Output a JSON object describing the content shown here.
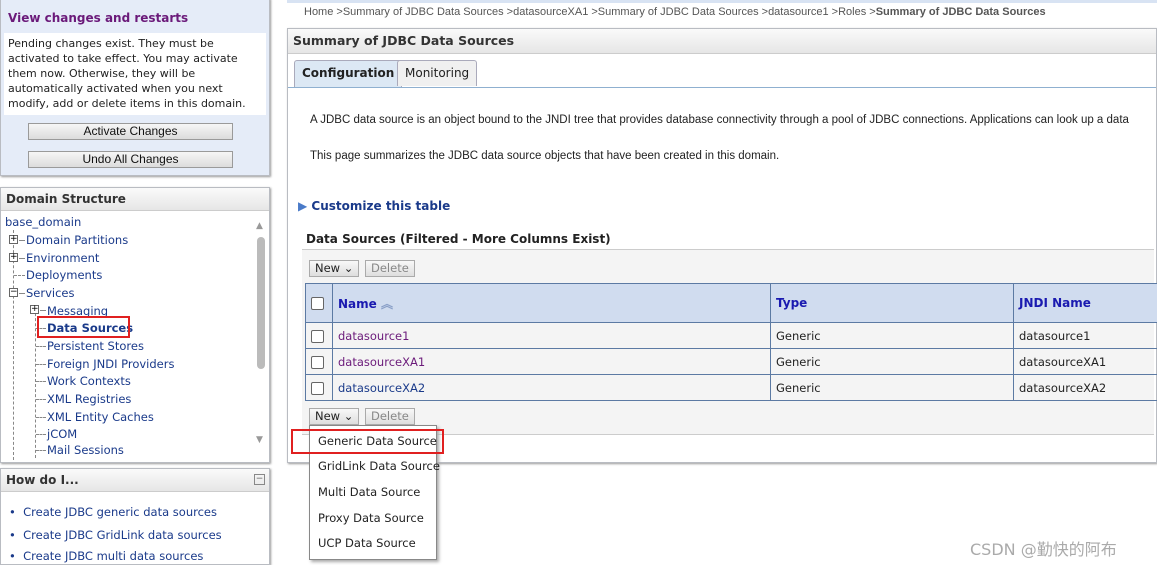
{
  "change_center": {
    "title": "View changes and restarts",
    "message": "Pending changes exist. They must be activated to take effect. You may activate them now. Otherwise, they will be automatically activated when you next modify, add or delete items in this domain.",
    "activate_label": "Activate Changes",
    "undo_label": "Undo All Changes"
  },
  "domain_structure": {
    "title": "Domain Structure",
    "root": "base_domain",
    "items": [
      "Domain Partitions",
      "Environment",
      "Deployments",
      "Services",
      "Messaging",
      "Data Sources",
      "Persistent Stores",
      "Foreign JNDI Providers",
      "Work Contexts",
      "XML Registries",
      "XML Entity Caches",
      "jCOM",
      "Mail Sessions"
    ]
  },
  "how_do_i": {
    "title": "How do I...",
    "links": [
      "Create JDBC generic data sources",
      "Create JDBC GridLink data sources",
      "Create JDBC multi data sources"
    ]
  },
  "breadcrumb": {
    "items": [
      "Home >",
      "Summary of JDBC Data Sources >",
      "datasourceXA1 >",
      "Summary of JDBC Data Sources >",
      "datasource1 >",
      "Roles >"
    ],
    "current": "Summary of JDBC Data Sources"
  },
  "page": {
    "title": "Summary of JDBC Data Sources",
    "tabs": [
      "Configuration",
      "Monitoring"
    ],
    "desc1": "A JDBC data source is an object bound to the JNDI tree that provides database connectivity through a pool of JDBC connections. Applications can look up a data",
    "desc2": "This page summarizes the JDBC data source objects that have been created in this domain.",
    "customize": "Customize this table",
    "table_title": "Data Sources (Filtered - More Columns Exist)",
    "new_label": "New",
    "delete_label": "Delete"
  },
  "table": {
    "columns": [
      "Name",
      "Type",
      "JNDI Name"
    ],
    "rows": [
      [
        "datasource1",
        "Generic",
        "datasource1"
      ],
      [
        "datasourceXA1",
        "Generic",
        "datasourceXA1"
      ],
      [
        "datasourceXA2",
        "Generic",
        "datasourceXA2"
      ]
    ]
  },
  "new_menu": [
    "Generic Data Source",
    "GridLink Data Source",
    "Multi Data Source",
    "Proxy Data Source",
    "UCP Data Source"
  ],
  "watermark": "CSDN @勤快的阿布",
  "colors": {
    "highlight": "#e02020",
    "header_bg": "#d0dcef",
    "link": "#1a3a8a"
  }
}
